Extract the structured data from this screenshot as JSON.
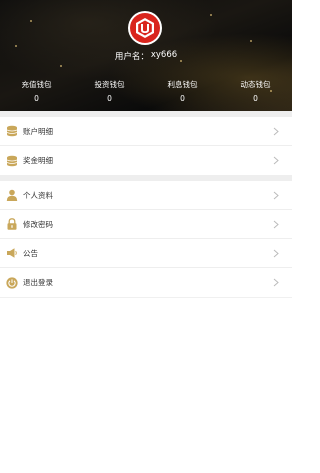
{
  "header": {
    "username_label": "用户名：",
    "username_value": "xy666",
    "brand_color": "#d9251d"
  },
  "wallets": [
    {
      "label": "充值钱包",
      "value": "0"
    },
    {
      "label": "投资钱包",
      "value": "0"
    },
    {
      "label": "利息钱包",
      "value": "0"
    },
    {
      "label": "动态钱包",
      "value": "0"
    }
  ],
  "menu_group_1": [
    {
      "label": "账户明细",
      "icon": "coins-icon"
    },
    {
      "label": "奖金明细",
      "icon": "coins-icon"
    }
  ],
  "menu_group_2": [
    {
      "label": "个人资料",
      "icon": "user-icon"
    },
    {
      "label": "修改密码",
      "icon": "lock-icon"
    },
    {
      "label": "公告",
      "icon": "megaphone-icon"
    },
    {
      "label": "退出登录",
      "icon": "power-icon"
    }
  ],
  "colors": {
    "icon_gold": "#c9a75a",
    "divider": "#eeeeee",
    "text": "#333333",
    "chevron": "#bbbbbb"
  }
}
